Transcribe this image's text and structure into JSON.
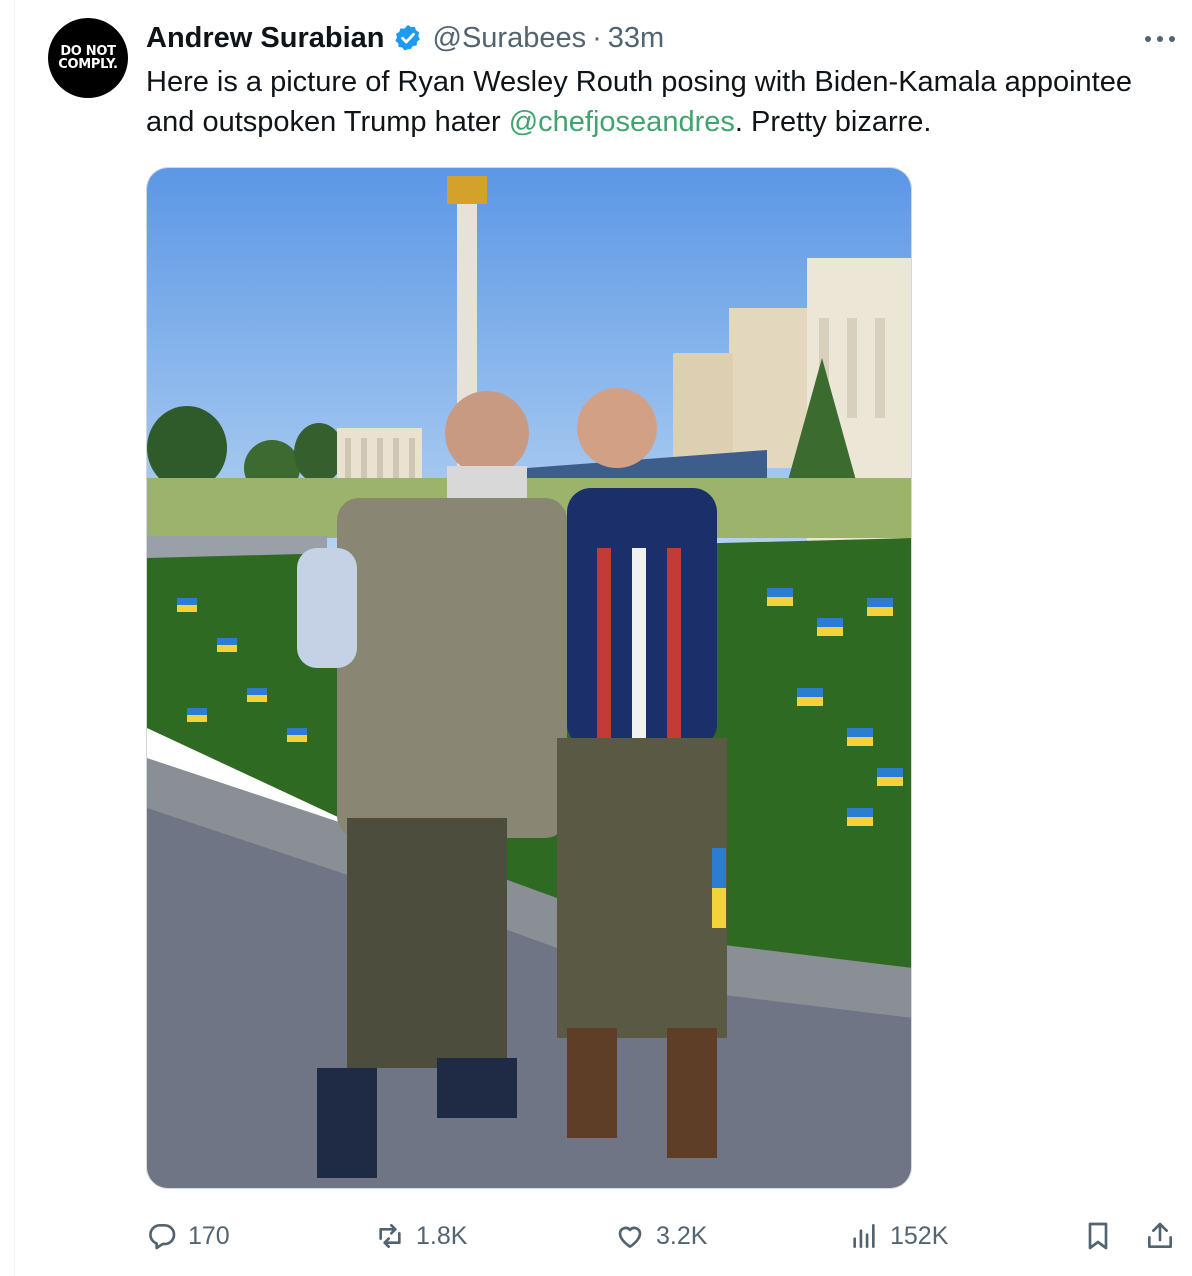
{
  "author": {
    "avatar_text_line1": "DO NOT",
    "avatar_text_line2": "COMPLY.",
    "name": "Andrew Surabian",
    "handle": "@Surabees",
    "separator": "·",
    "time": "33m"
  },
  "tweet": {
    "text_before": "Here is a picture of Ryan Wesley Routh posing with Biden-Kamala appointee and outspoken Trump hater ",
    "mention": "@chefjoseandres",
    "text_after": ". Pretty bizarre."
  },
  "actions": {
    "replies": "170",
    "reposts": "1.8K",
    "likes": "3.2K",
    "views": "152K"
  },
  "icons": [
    "verified-badge-icon",
    "more-options-icon",
    "reply-icon",
    "repost-icon",
    "like-icon",
    "views-icon",
    "bookmark-icon",
    "share-icon"
  ],
  "colors": {
    "text": "#0f1419",
    "secondary": "#536471",
    "mention": "#41a36e",
    "verified": "#1d9bf0"
  }
}
